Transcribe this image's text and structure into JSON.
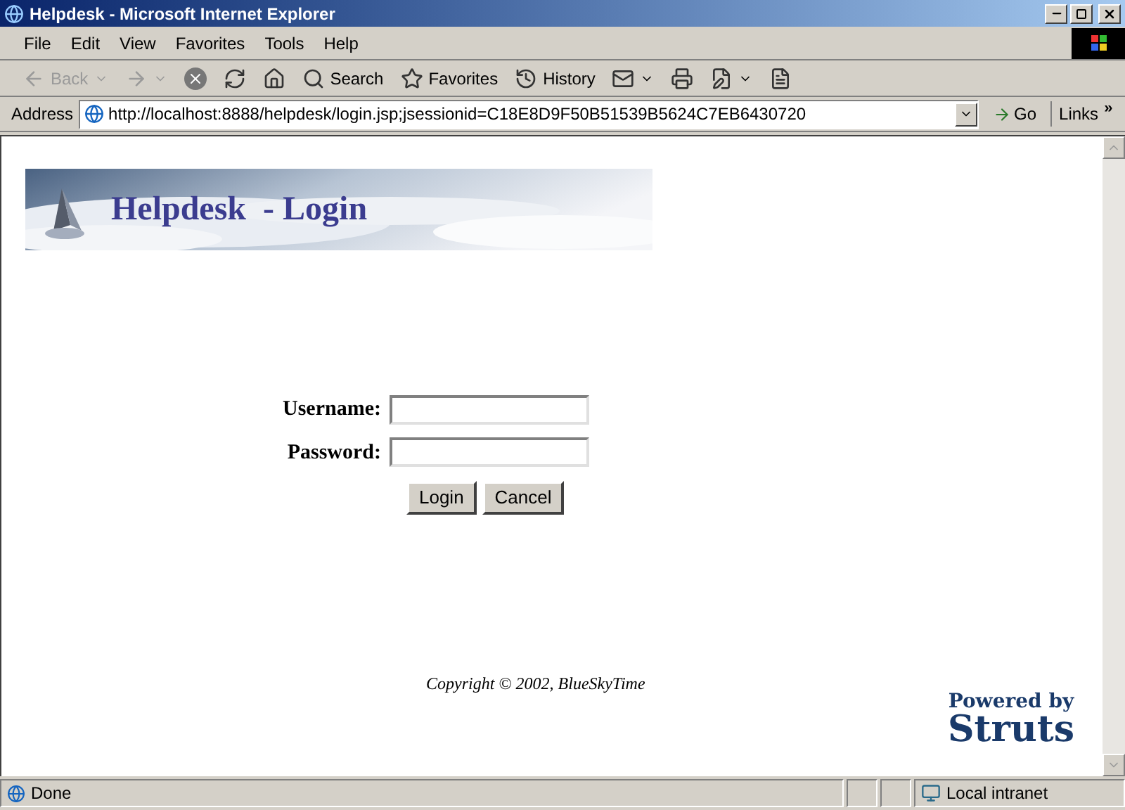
{
  "window": {
    "title": "Helpdesk - Microsoft Internet Explorer"
  },
  "menu": [
    "File",
    "Edit",
    "View",
    "Favorites",
    "Tools",
    "Help"
  ],
  "toolbar": [
    {
      "kind": "back",
      "label": "Back",
      "disabled": true
    },
    {
      "kind": "forward",
      "disabled": true
    },
    {
      "kind": "stop",
      "disabled": false
    },
    {
      "kind": "refresh",
      "disabled": false
    },
    {
      "kind": "home",
      "disabled": false
    },
    {
      "kind": "search",
      "label": "Search",
      "disabled": false
    },
    {
      "kind": "favorites",
      "label": "Favorites",
      "disabled": false
    },
    {
      "kind": "history",
      "label": "History",
      "disabled": false
    },
    {
      "kind": "mail",
      "disabled": false
    },
    {
      "kind": "print",
      "disabled": false
    },
    {
      "kind": "edit",
      "disabled": false
    },
    {
      "kind": "discuss",
      "disabled": false
    }
  ],
  "address": {
    "label": "Address",
    "value": "http://localhost:8888/helpdesk/login.jsp;jsessionid=C18E8D9F50B51539B5624C7EB6430720",
    "go": "Go",
    "links": "Links",
    "more": "»"
  },
  "banner": {
    "title": "Helpdesk  - Login"
  },
  "form": {
    "fields": [
      {
        "label": "Username:"
      },
      {
        "label": "Password:"
      }
    ],
    "buttons": [
      "Login",
      "Cancel"
    ]
  },
  "footer": {
    "copyright": "Copyright © 2002, BlueSkyTime",
    "powered": "Powered by",
    "brand": "Struts"
  },
  "status": {
    "text": "Done",
    "zone": "Local intranet"
  }
}
